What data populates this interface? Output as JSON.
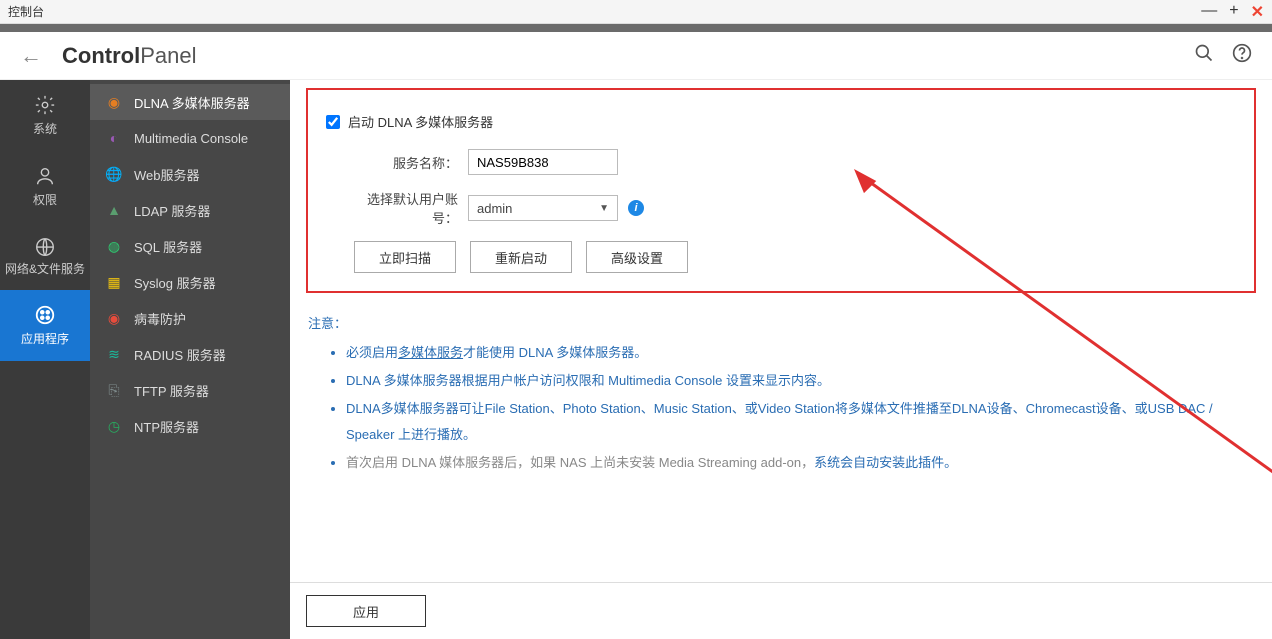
{
  "window": {
    "title": "控制台"
  },
  "header": {
    "brand_bold": "Control",
    "brand_light": "Panel"
  },
  "rail": [
    {
      "label": "系统"
    },
    {
      "label": "权限"
    },
    {
      "label": "网络&文件服务",
      "multiline": true
    },
    {
      "label": "应用程序"
    }
  ],
  "sidebar": [
    {
      "label": "DLNA 多媒体服务器",
      "icon_color": "#e67e22"
    },
    {
      "label": "Multimedia Console",
      "icon_color": "#9b59b6"
    },
    {
      "label": "Web服务器",
      "icon_color": "#3498db"
    },
    {
      "label": "LDAP 服务器",
      "icon_color": "#5a9e6f"
    },
    {
      "label": "SQL 服务器",
      "icon_color": "#2ecc71"
    },
    {
      "label": "Syslog 服务器",
      "icon_color": "#f1c40f"
    },
    {
      "label": "病毒防护",
      "icon_color": "#e74c3c"
    },
    {
      "label": "RADIUS 服务器",
      "icon_color": "#1abc9c"
    },
    {
      "label": "TFTP 服务器",
      "icon_color": "#7f8c8d"
    },
    {
      "label": "NTP服务器",
      "icon_color": "#27ae60"
    }
  ],
  "form": {
    "enable_label": "启动 DLNA 多媒体服务器",
    "enable_checked": true,
    "service_name_label": "服务名称：",
    "service_name_value": "NAS59B838",
    "default_user_label": "选择默认用户账号：",
    "default_user_value": "admin",
    "buttons": {
      "scan": "立即扫描",
      "restart": "重新启动",
      "advanced": "高级设置"
    }
  },
  "notice": {
    "heading": "注意：",
    "items": [
      {
        "pre": "必须启用",
        "link": "多媒体服务",
        "post": "才能使用 DLNA 多媒体服务器。"
      },
      {
        "text": "DLNA 多媒体服务器根据用户帐户访问权限和 Multimedia Console 设置来显示内容。"
      },
      {
        "text": "DLNA多媒体服务器可让File Station、Photo Station、Music Station、或Video Station将多媒体文件推播至DLNA设备、Chromecast设备、或USB DAC / Speaker 上进行播放。"
      },
      {
        "pre_gray": "首次启用 DLNA 媒体服务器后，如果 NAS 上尚未安装 Media Streaming add-on，",
        "text": "系统会自动安装此插件。"
      }
    ]
  },
  "footer": {
    "apply": "应用"
  }
}
